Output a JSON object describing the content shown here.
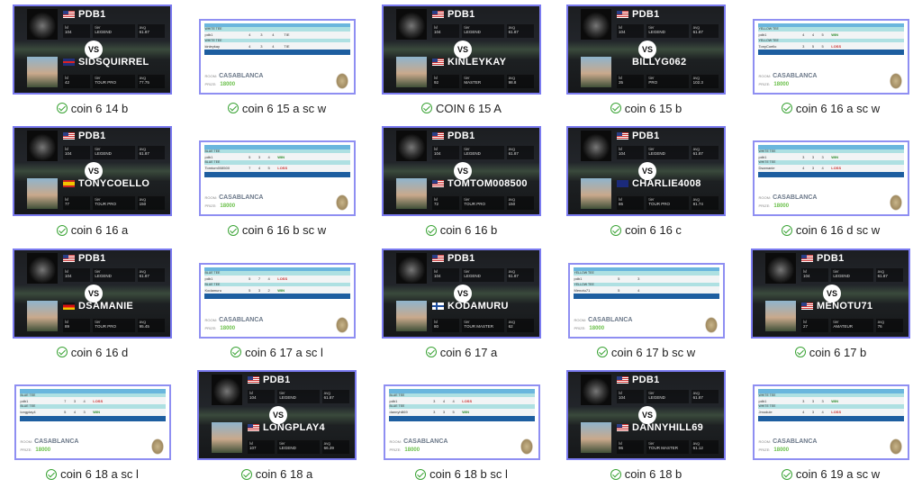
{
  "me": {
    "name": "PDB1",
    "flag": "us",
    "lvl": "104",
    "tier": "LEGEND",
    "avg": "61.87"
  },
  "stat_labels": {
    "lvl": "lvl",
    "tier": "tier",
    "avg": "avg"
  },
  "vs_label": "VS",
  "room_label": "ROOM:",
  "room": "CASABLANCA",
  "prize_label": "PRIZE:",
  "prize": "18000",
  "items": [
    {
      "label": "coin 6 14 b",
      "type": "vs",
      "opp": {
        "name": "SIDSQUIRREL",
        "flag": "uk",
        "lvl": "42",
        "tier": "TOUR PRO",
        "avg": "77.75"
      }
    },
    {
      "label": "coin 6 15 a sc w",
      "type": "score",
      "tee": "WHITE TEE",
      "rows": [
        {
          "name": "pdb1",
          "s": [
            "4",
            "3",
            "4"
          ],
          "r": "TIE"
        },
        {
          "name": "kinleykay",
          "s": [
            "4",
            "3",
            "4"
          ],
          "r": "TIE"
        }
      ]
    },
    {
      "label": "COIN 6 15 A",
      "type": "vs",
      "opp": {
        "name": "KINLEYKAY",
        "flag": "us",
        "lvl": "92",
        "tier": "MASTER",
        "avg": "98.8"
      }
    },
    {
      "label": "coin 6 15 b",
      "type": "vs",
      "opp": {
        "name": "BILLYG062",
        "flag": "",
        "lvl": "35",
        "tier": "PRO",
        "avg": "102.3"
      }
    },
    {
      "label": "coin 6 16 a sc w",
      "type": "score",
      "tee": "YELLOW TEE",
      "rows": [
        {
          "name": "pdb1",
          "s": [
            "4",
            "4",
            "5"
          ],
          "r": "WIN"
        },
        {
          "name": "TonyCoello",
          "s": [
            "3",
            "5",
            "5"
          ],
          "r": "LOSS"
        }
      ]
    },
    {
      "label": "coin 6 16 a",
      "type": "vs",
      "opp": {
        "name": "TONYCOELLO",
        "flag": "es",
        "lvl": "77",
        "tier": "TOUR PRO",
        "avg": "150"
      }
    },
    {
      "label": "coin 6 16 b sc w",
      "type": "score",
      "tee": "BLUE TEE",
      "rows": [
        {
          "name": "pdb1",
          "s": [
            "5",
            "3",
            "4"
          ],
          "r": "WIN"
        },
        {
          "name": "Tomtom008500",
          "s": [
            "7",
            "4",
            "5"
          ],
          "r": "LOSS"
        }
      ]
    },
    {
      "label": "coin 6 16 b",
      "type": "vs",
      "opp": {
        "name": "TOMTOM008500",
        "flag": "us",
        "lvl": "72",
        "tier": "TOUR PRO",
        "avg": "150"
      }
    },
    {
      "label": "coin 6 16 c",
      "type": "vs",
      "opp": {
        "name": "CHARLIE4008",
        "flag": "au",
        "lvl": "86",
        "tier": "TOUR PRO",
        "avg": "81.74"
      }
    },
    {
      "label": "coin 6 16 d sc w",
      "type": "score",
      "tee": "WHITE TEE",
      "rows": [
        {
          "name": "pdb1",
          "s": [
            "3",
            "3",
            "3"
          ],
          "r": "WIN"
        },
        {
          "name": "Dsamanie",
          "s": [
            "4",
            "3",
            "4"
          ],
          "r": "LOSS"
        }
      ]
    },
    {
      "label": "coin 6 16 d",
      "type": "vs",
      "opp": {
        "name": "DSAMANIE",
        "flag": "de",
        "lvl": "89",
        "tier": "TOUR PRO",
        "avg": "95.45"
      }
    },
    {
      "label": "coin 6 17 a sc l",
      "type": "score",
      "tee": "BLUE TEE",
      "rows": [
        {
          "name": "pdb1",
          "s": [
            "5",
            "7",
            "4"
          ],
          "r": "LOSS"
        },
        {
          "name": "Kodamuru",
          "s": [
            "5",
            "3",
            "2"
          ],
          "r": "WIN"
        }
      ]
    },
    {
      "label": "coin 6 17 a",
      "type": "vs",
      "opp": {
        "name": "KODAMURU",
        "flag": "fi",
        "lvl": "80",
        "tier": "TOUR MASTER",
        "avg": "62"
      }
    },
    {
      "label": "coin 6 17 b sc w",
      "type": "score",
      "tee": "YELLOW TEE",
      "rows": [
        {
          "name": "pdb1",
          "s": [
            "5",
            "3",
            ""
          ],
          "r": ""
        },
        {
          "name": "Menotu71",
          "s": [
            "5",
            "4",
            ""
          ],
          "r": ""
        }
      ]
    },
    {
      "label": "coin 6 17 b",
      "type": "vs",
      "opp": {
        "name": "MENOTU71",
        "flag": "us",
        "lvl": "27",
        "tier": "AMATEUR",
        "avg": "76"
      }
    },
    {
      "label": "coin 6 18 a sc l",
      "type": "score",
      "tee": "BLUE TEE",
      "rows": [
        {
          "name": "pdb1",
          "s": [
            "7",
            "3",
            "4"
          ],
          "r": "LOSS"
        },
        {
          "name": "longplay4",
          "s": [
            "5",
            "4",
            "3"
          ],
          "r": "WIN"
        }
      ]
    },
    {
      "label": "coin 6 18 a",
      "type": "vs",
      "opp": {
        "name": "LONGPLAY4",
        "flag": "us",
        "lvl": "107",
        "tier": "LEGEND",
        "avg": "66.39"
      }
    },
    {
      "label": "coin 6 18 b sc l",
      "type": "score",
      "tee": "BLUE TEE",
      "rows": [
        {
          "name": "pdb1",
          "s": [
            "3",
            "4",
            "4"
          ],
          "r": "LOSS"
        },
        {
          "name": "dannyhill69",
          "s": [
            "3",
            "3",
            "5"
          ],
          "r": "WIN"
        }
      ]
    },
    {
      "label": "coin 6 18 b",
      "type": "vs",
      "opp": {
        "name": "DANNYHILL69",
        "flag": "us",
        "lvl": "96",
        "tier": "TOUR MASTER",
        "avg": "61.12"
      }
    },
    {
      "label": "coin 6 19 a sc w",
      "type": "score",
      "tee": "WHITE TEE",
      "rows": [
        {
          "name": "pdb1",
          "s": [
            "3",
            "3",
            "3"
          ],
          "r": "WIN"
        },
        {
          "name": "Jmodule",
          "s": [
            "4",
            "3",
            "4"
          ],
          "r": "LOSS"
        }
      ]
    }
  ],
  "colors": {
    "selection": "#7b7bf0",
    "check": "#3aa335",
    "win": "#2a8a2a",
    "loss": "#c33333",
    "prize": "#6bc04b"
  }
}
